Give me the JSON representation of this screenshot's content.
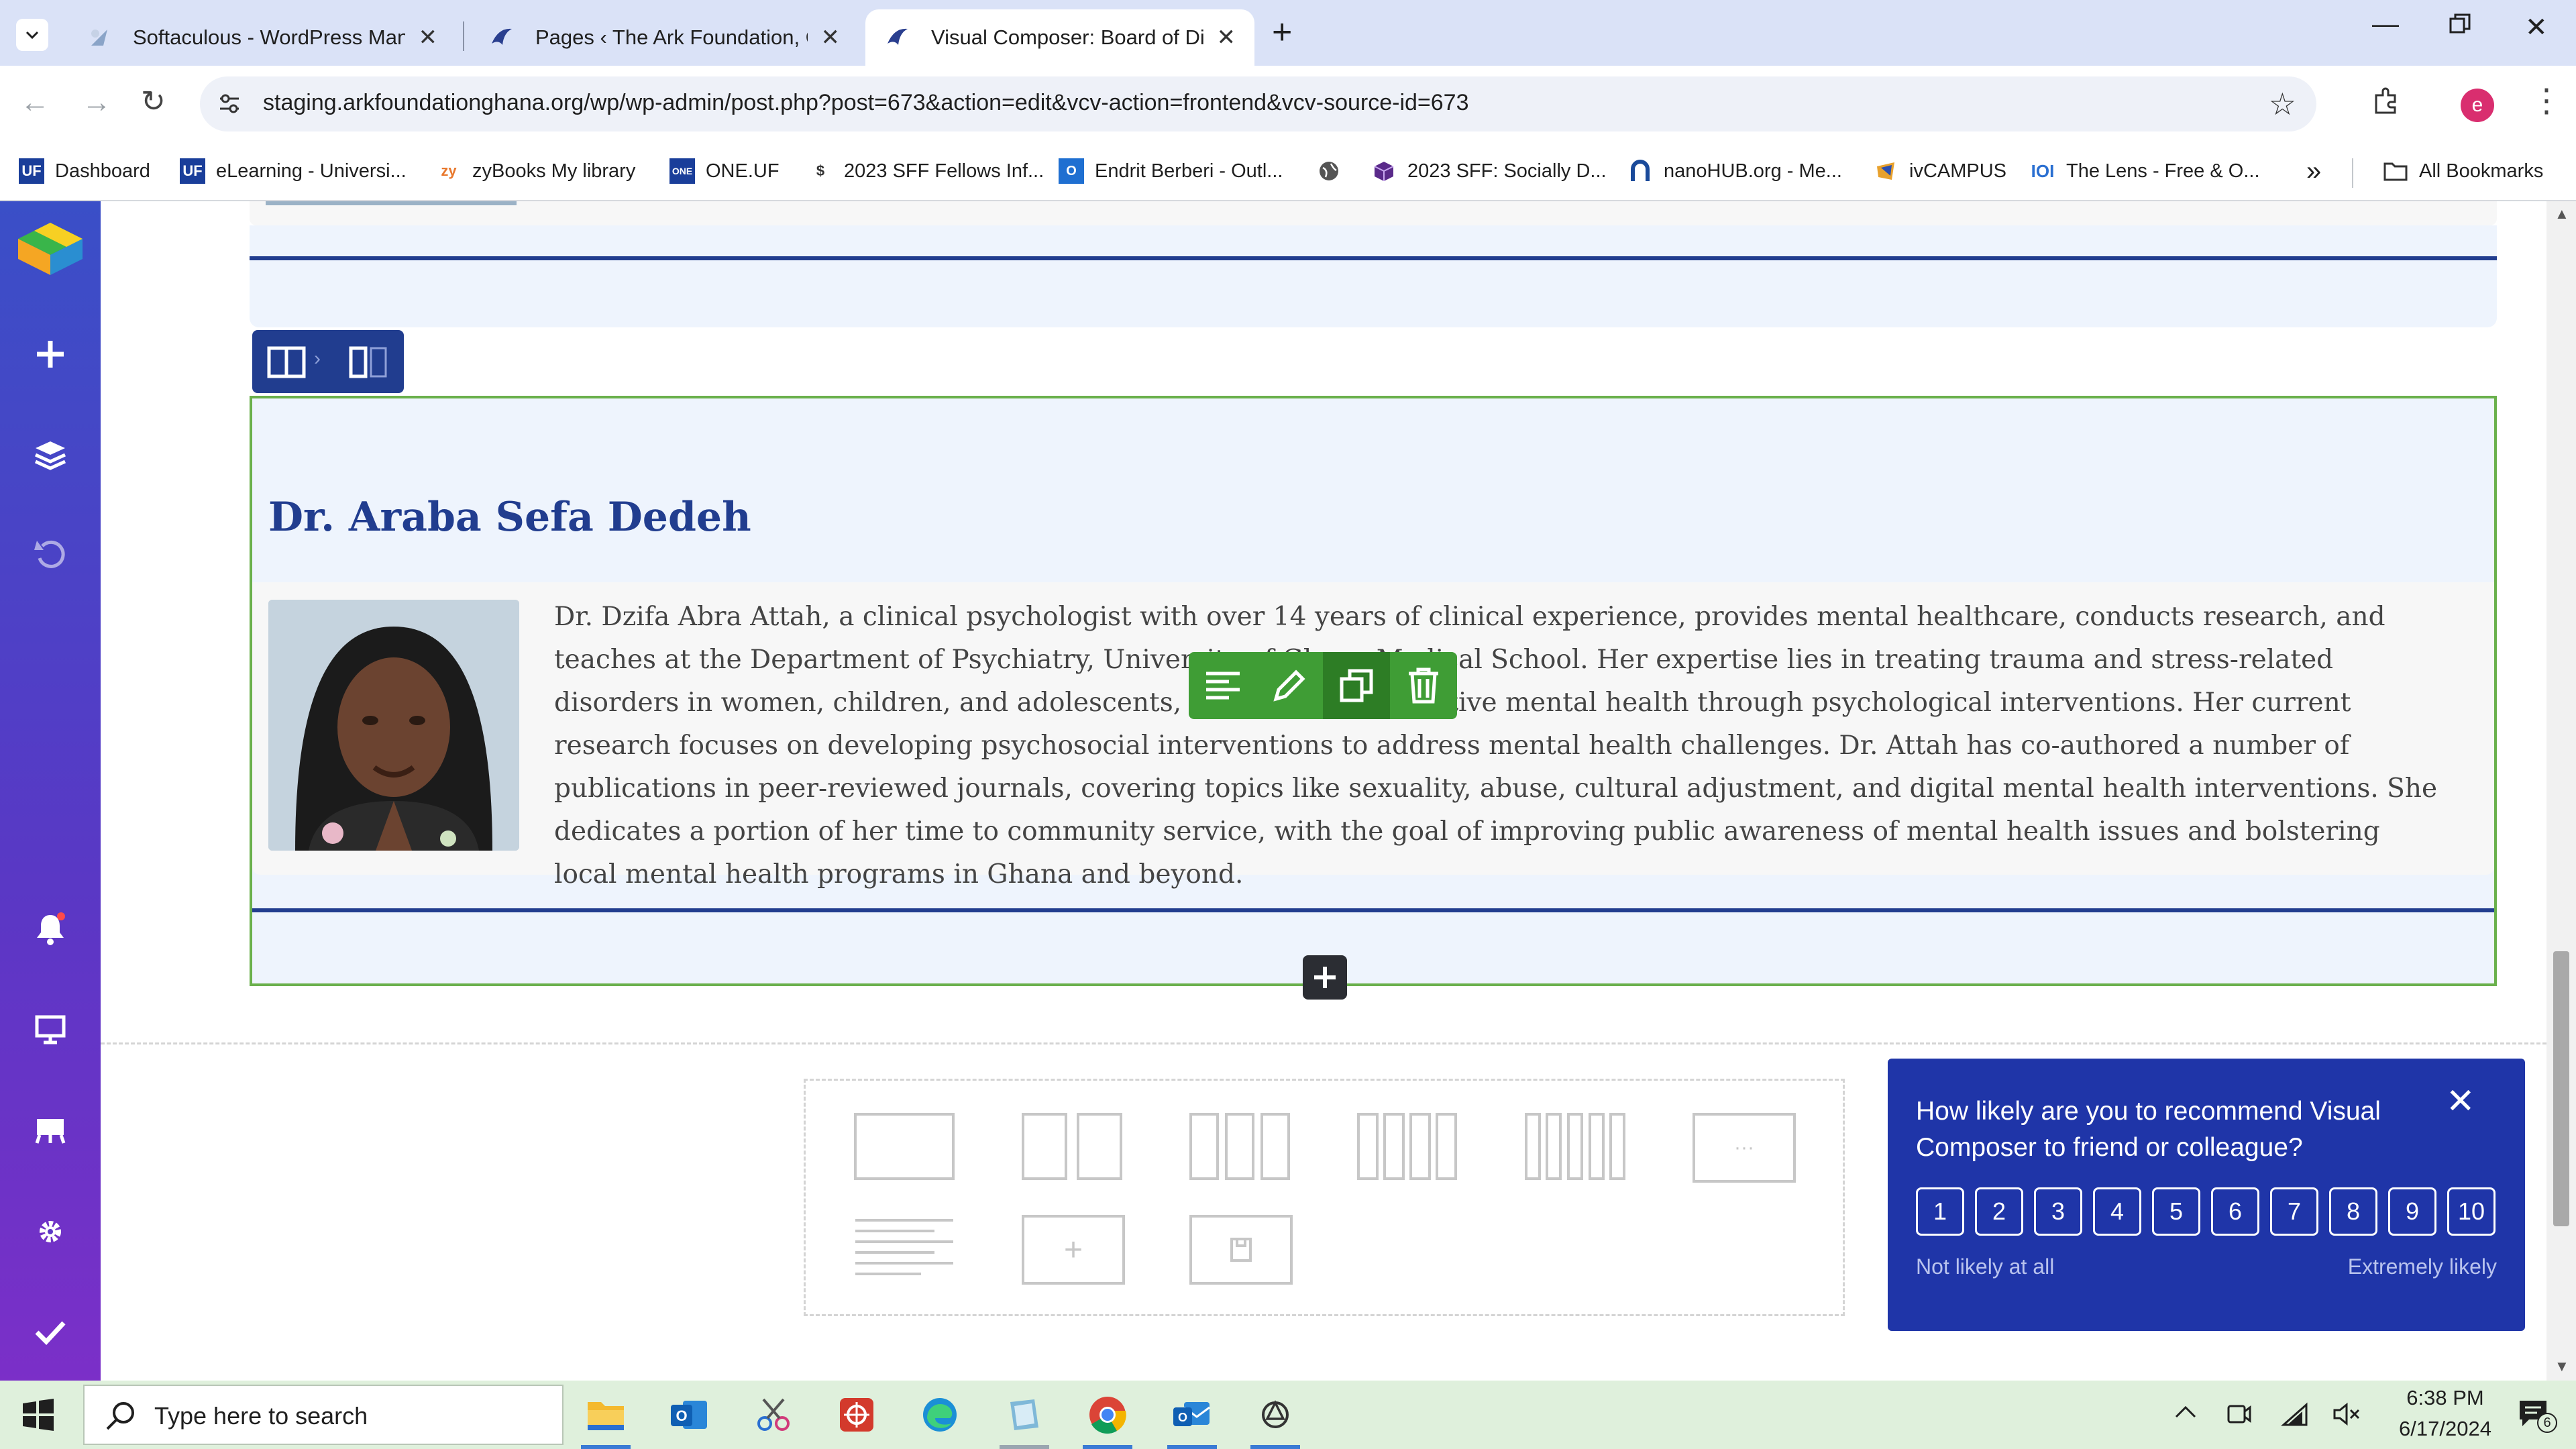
{
  "browser": {
    "tabs": [
      {
        "label": "Softaculous - WordPress Manag",
        "active": false
      },
      {
        "label": "Pages ‹ The Ark Foundation, Gh",
        "active": false
      },
      {
        "label": "Visual Composer: Board of Dire",
        "active": true
      }
    ],
    "new_tab": "+",
    "url": "staging.arkfoundationghana.org/wp/wp-admin/post.php?post=673&action=edit&vcv-action=frontend&vcv-source-id=673",
    "profile_initial": "e"
  },
  "bookmarks": [
    {
      "label": "Dashboard",
      "icon": "uf-icon"
    },
    {
      "label": "eLearning - Universi...",
      "icon": "uf-icon"
    },
    {
      "label": "zyBooks My library",
      "icon": "zy-icon"
    },
    {
      "label": "ONE.UF",
      "icon": "one-uf-icon"
    },
    {
      "label": "2023 SFF Fellows Inf...",
      "icon": "doc-icon"
    },
    {
      "label": "Endrit Berberi - Outl...",
      "icon": "outlook-icon"
    },
    {
      "label": "",
      "icon": "globe-icon"
    },
    {
      "label": "2023 SFF: Socially D...",
      "icon": "cube-icon"
    },
    {
      "label": "nanoHUB.org - Me...",
      "icon": "nanohub-icon"
    },
    {
      "label": "ivCAMPUS",
      "icon": "ivcampus-icon"
    },
    {
      "label": "The Lens - Free & O...",
      "icon": "lens-icon"
    }
  ],
  "bookmarks_overflow": "»",
  "all_bookmarks": "All Bookmarks",
  "profile": {
    "name": "Dr. Araba Sefa Dedeh",
    "bio": "Dr. Dzifa Abra Attah, a clinical psychologist with over 14 years of clinical experience, provides mental healthcare, conducts research, and teaches at the Department of Psychiatry, University of Ghana Medical School. Her expertise lies in treating trauma and stress-related disorders in women, children, and adolescents, and promoting positive mental health through psychological interventions. Her current research focuses on developing psychosocial interventions to address mental health challenges. Dr. Attah has co-authored a number of publications in peer-reviewed journals, covering topics like sexuality, abuse, cultural adjustment, and digital mental health interventions. She dedicates a portion of her time to community service, with the goal of improving public awareness of mental health issues and bolstering local mental health programs in Ghana and beyond."
  },
  "editor": {
    "add_element": "+",
    "layout_more": "···"
  },
  "survey": {
    "question": "How likely are you to recommend Visual Composer to friend or colleague?",
    "scores": [
      "1",
      "2",
      "3",
      "4",
      "5",
      "6",
      "7",
      "8",
      "9",
      "10"
    ],
    "low_label": "Not likely at all",
    "high_label": "Extremely likely",
    "close": "✕"
  },
  "taskbar": {
    "search_placeholder": "Type here to search",
    "time": "6:38 PM",
    "date": "6/17/2024",
    "notification_count": "6"
  },
  "colors": {
    "accent_blue": "#213d8f",
    "vc_sidebar_top": "#3a4fc7",
    "vc_sidebar_bottom": "#7b2fc8",
    "element_green": "#3f9d35",
    "survey_bg": "#1f35a8",
    "section_bg": "#eef4fd"
  }
}
